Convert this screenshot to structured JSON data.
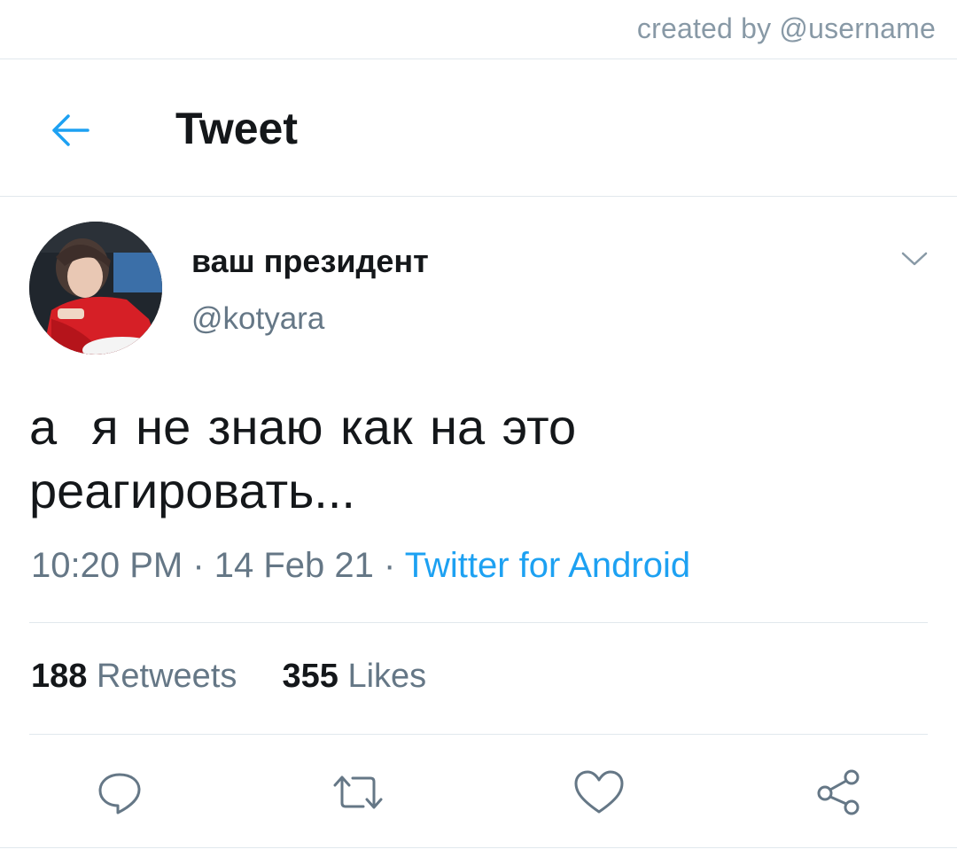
{
  "credit": "created by @username",
  "header": {
    "title": "Tweet",
    "back_icon": "arrow-left-icon",
    "accent": "#1da1f2"
  },
  "author": {
    "display_name": "ваш президент",
    "handle": "@kotyara",
    "menu_icon": "chevron-down-icon"
  },
  "tweet": {
    "text_line1": "а  я не знаю как на это",
    "text_line2": "реагировать...",
    "time": "10:20 PM",
    "date": "14 Feb 21",
    "separator": " · ",
    "source": "Twitter for Android"
  },
  "stats": {
    "retweets_count": "188",
    "retweets_label": "Retweets",
    "likes_count": "355",
    "likes_label": "Likes"
  },
  "actions": [
    "reply-icon",
    "retweet-icon",
    "like-icon",
    "share-icon"
  ],
  "colors": {
    "text": "#14171a",
    "secondary": "#657786",
    "icon": "#657786",
    "divider": "#e1e8ed"
  }
}
